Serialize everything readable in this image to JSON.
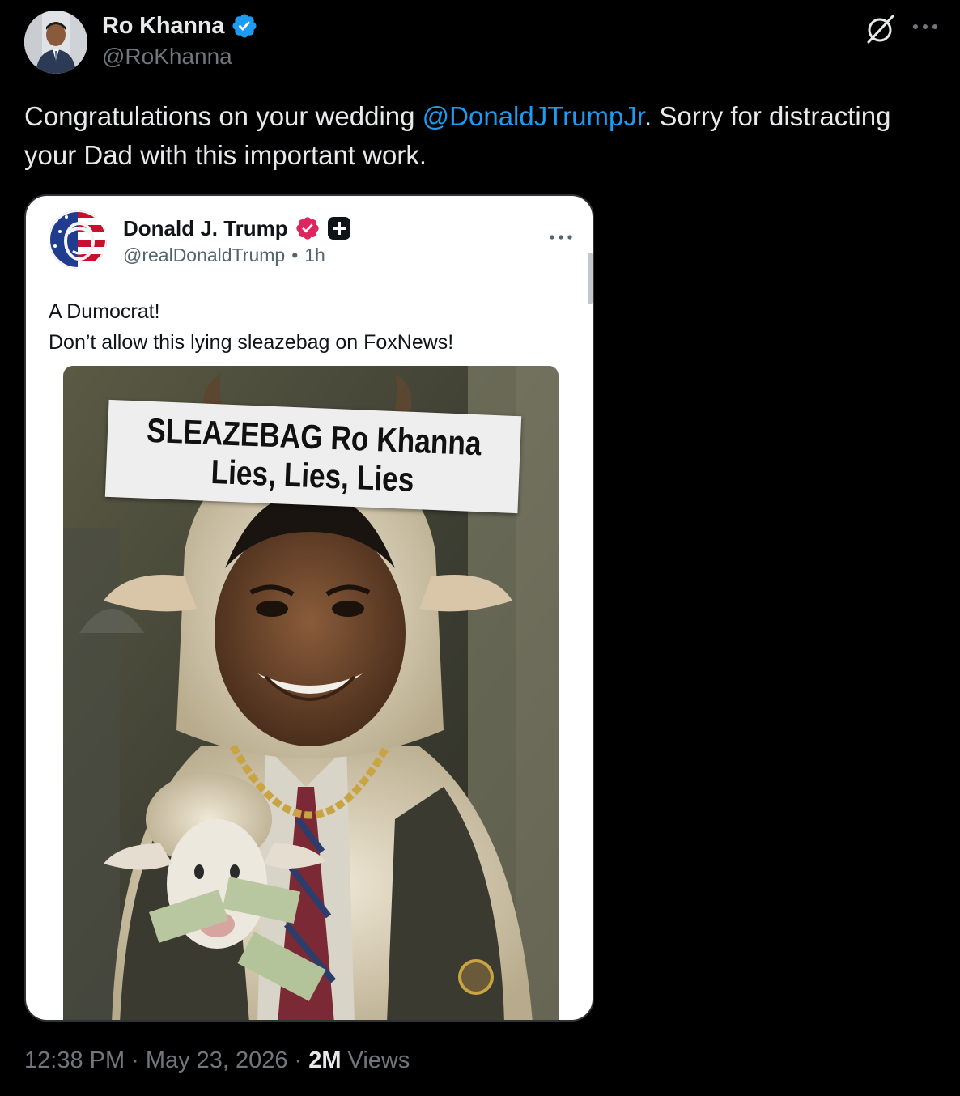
{
  "author": {
    "display_name": "Ro Khanna",
    "handle": "@RoKhanna",
    "verified_color": "#1d9bf0"
  },
  "header_icons": {
    "grok": "grok-icon",
    "more": "more-icon"
  },
  "tweet": {
    "text_before": "Congratulations on your wedding ",
    "mention": "@DonaldJTrumpJr",
    "text_after": ". Sorry for distracting your Dad with this important work."
  },
  "embedded_post": {
    "display_name": "Donald J. Trump",
    "handle": "@realDonaldTrump",
    "separator": "•",
    "time": "1h",
    "badge_color": "#e0245e",
    "lines": [
      "A Dumocrat!",
      "Don’t allow this lying sleazebag on FoxNews!"
    ],
    "image": {
      "banner_line1": "SLEAZEBAG Ro Khanna",
      "banner_line2": "Lies, Lies, Lies"
    }
  },
  "footer": {
    "time": "12:38 PM",
    "sep": "·",
    "date": "May 23, 2026",
    "views_count": "2M",
    "views_label": "Views"
  },
  "colors": {
    "background": "#000000",
    "text": "#e7e9ea",
    "secondary": "#71767b",
    "link": "#1d9bf0"
  }
}
